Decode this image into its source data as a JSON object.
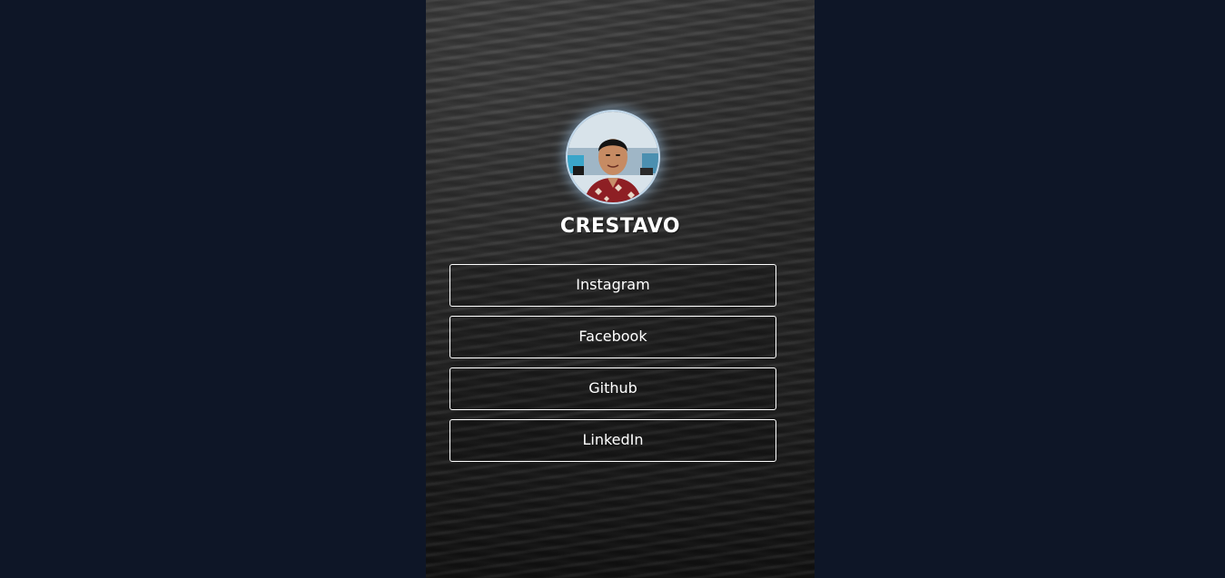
{
  "profile": {
    "name": "CRESTAVO",
    "avatar_alt": "profile photo"
  },
  "links": [
    {
      "label": "Instagram"
    },
    {
      "label": "Facebook"
    },
    {
      "label": "Github"
    },
    {
      "label": "LinkedIn"
    }
  ],
  "colors": {
    "page_background": "#0e1627",
    "text": "#ffffff",
    "button_border": "#ffffff",
    "avatar_glow": "#aad7ff"
  }
}
